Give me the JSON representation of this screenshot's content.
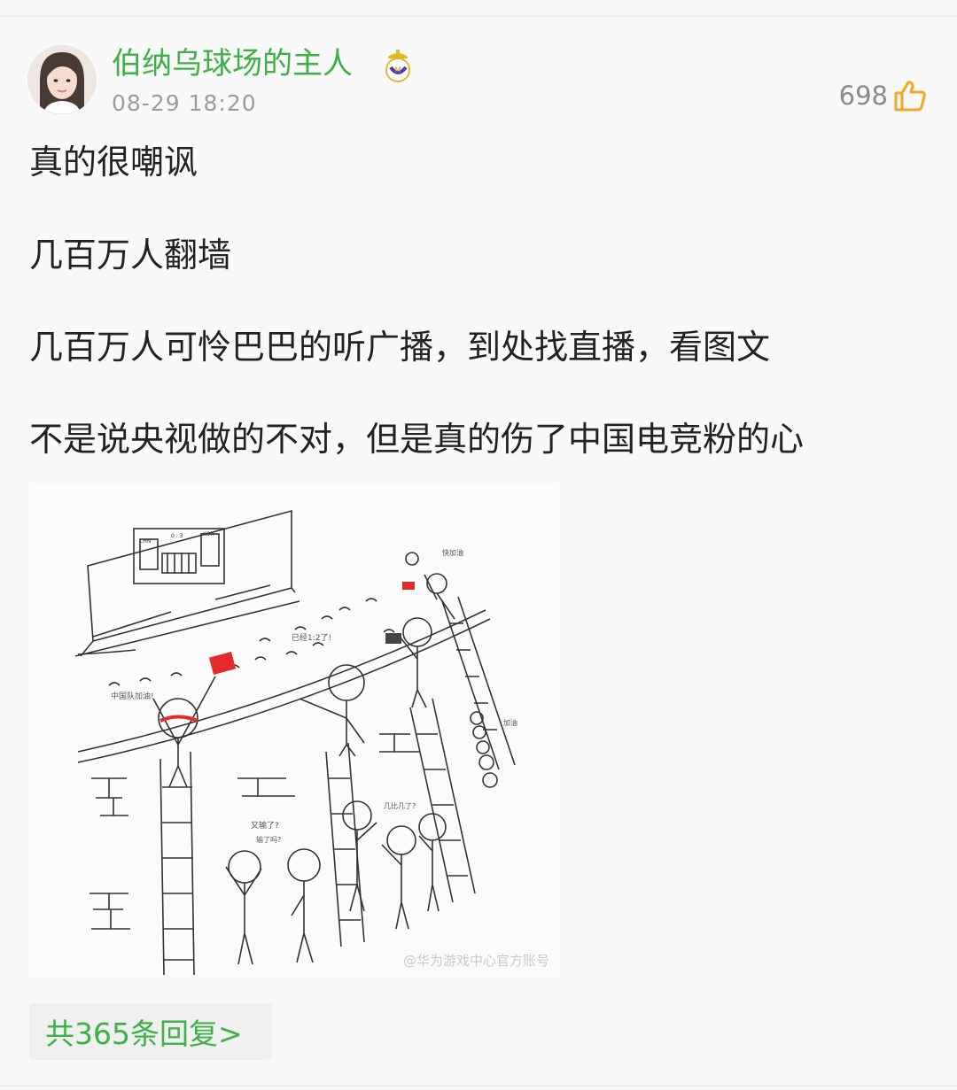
{
  "post": {
    "username": "伯纳乌球场的主人",
    "time": "08-29 18:20",
    "likes": "698",
    "paragraphs": [
      "真的很嘲讽",
      "几百万人翻墙",
      "几百万人可怜巴巴的听广播，到处找直播，看图文",
      "不是说央视做的不对，但是真的伤了中国电竞粉的心"
    ]
  },
  "illustration": {
    "screen": {
      "left_team": "CHN",
      "right_team": "KOR",
      "score": "0 : 3"
    },
    "bubbles": [
      "中国队加油!",
      "又输了?",
      "已经1:2了!",
      "快加油",
      "输了吗?",
      "几比几了?",
      "加油"
    ],
    "watermark": "@华为游戏中心官方账号"
  },
  "replies": {
    "label": "共365条回复>"
  },
  "colors": {
    "accent_green": "#3db046",
    "like_orange": "#f5a623",
    "text": "#222222",
    "muted": "#9b9b9b"
  },
  "icons": {
    "like": "thumbs-up-icon",
    "badge": "real-madrid-crest-icon"
  }
}
